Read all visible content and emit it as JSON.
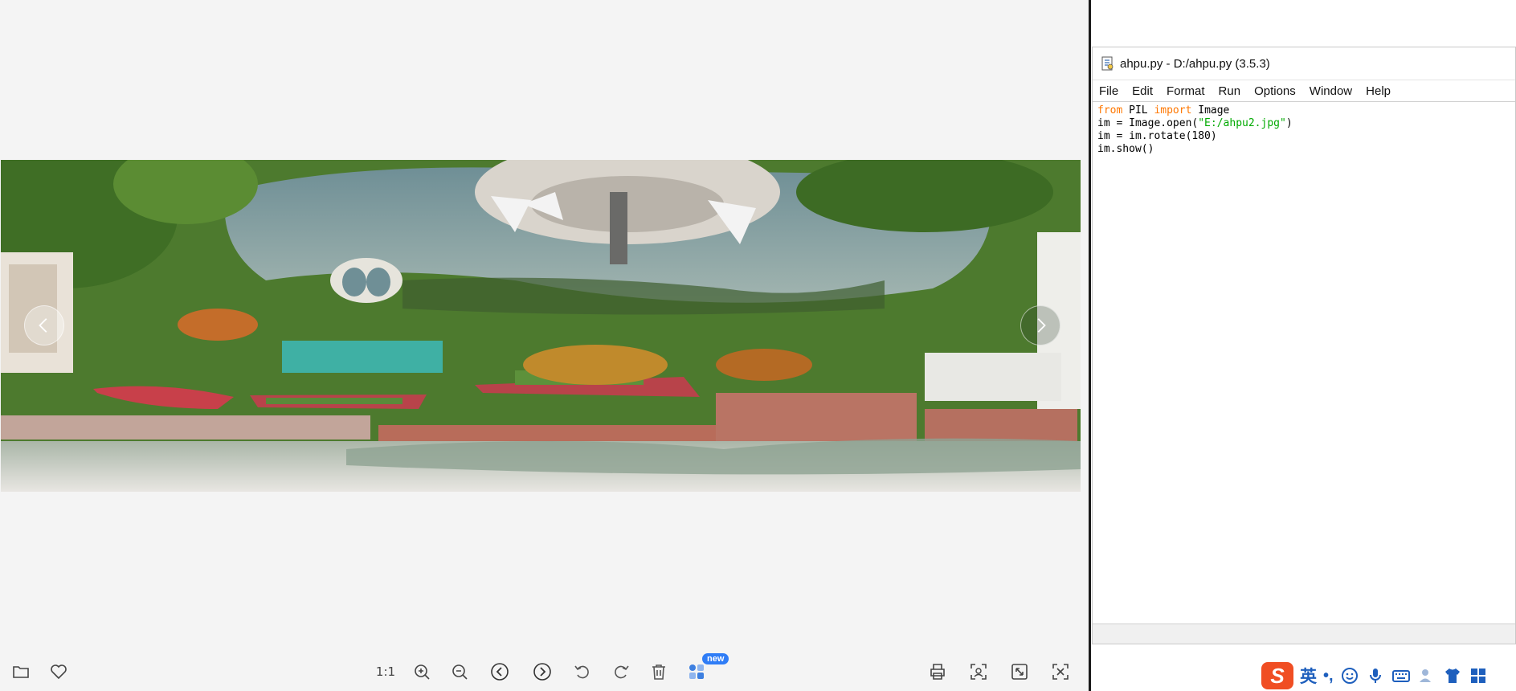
{
  "viewer": {
    "toolbar": {
      "ratio_label": "1:1",
      "new_badge": "new"
    },
    "icons": {
      "folder": "folder-icon",
      "favorite": "heart-icon",
      "zoom_in": "zoom-in-icon",
      "zoom_out": "zoom-out-icon",
      "previous": "chevron-left-circle-icon",
      "next": "chevron-right-circle-icon",
      "rotate_left": "rotate-left-icon",
      "rotate_right": "rotate-right-icon",
      "delete": "trash-icon",
      "apps": "apps-icon",
      "print": "printer-icon",
      "scan": "scan-icon",
      "fit": "fit-window-icon",
      "fullscreen": "fullscreen-icon"
    }
  },
  "idle": {
    "title": "ahpu.py - D:/ahpu.py (3.5.3)",
    "menu": [
      "File",
      "Edit",
      "Format",
      "Run",
      "Options",
      "Window",
      "Help"
    ],
    "code": {
      "line1": {
        "kw1": "from",
        "t1": " PIL ",
        "kw2": "import",
        "t2": " Image"
      },
      "line2": {
        "t1": "im = Image.open(",
        "str": "\"E:/ahpu2.jpg\"",
        "t2": ")"
      },
      "line3": "im = im.rotate(180)",
      "line4": "im.show()"
    }
  },
  "ime": {
    "lang": "英",
    "punct": "•,"
  },
  "colors": {
    "keyword": "#ff7700",
    "string": "#00aa00",
    "new_badge": "#2f7df6",
    "ime_logo": "#f04e23",
    "ime_blue": "#1e5fbd"
  }
}
